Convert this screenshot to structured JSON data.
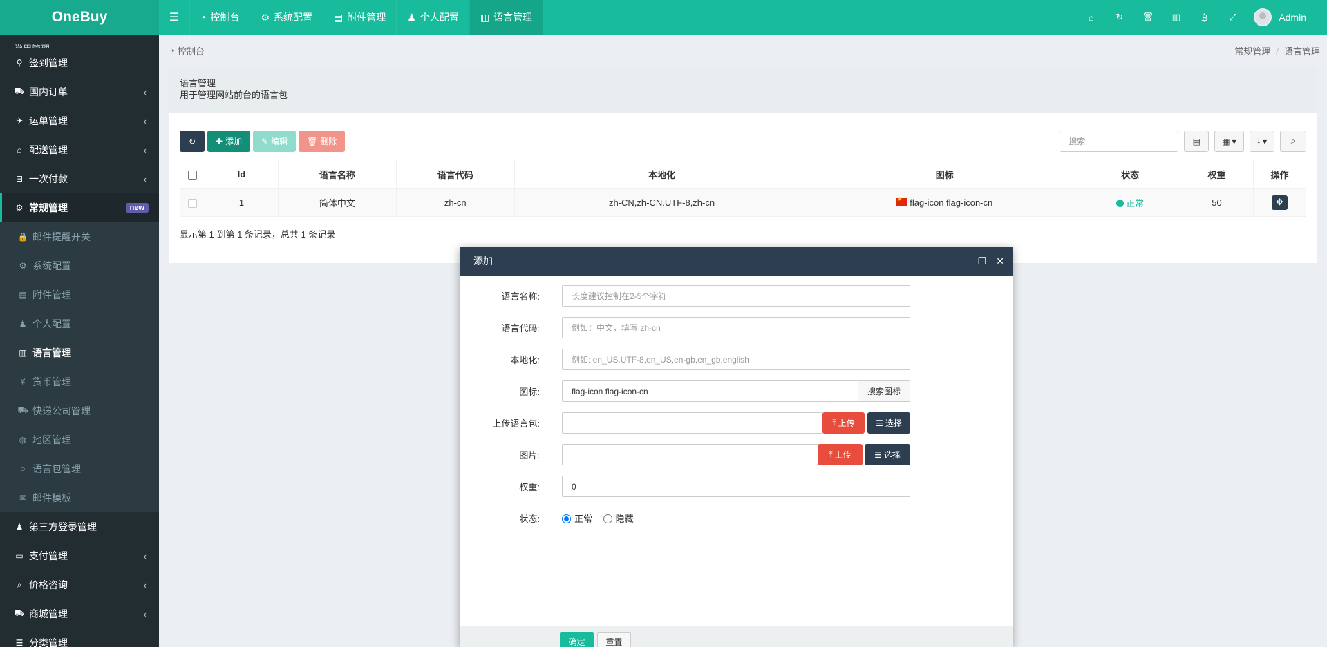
{
  "app": {
    "logo": "OneBuy"
  },
  "header": {
    "tabs": [
      {
        "icon": "dashboard-icon",
        "label": "控制台"
      },
      {
        "icon": "gear-icon",
        "label": "系统配置"
      },
      {
        "icon": "file-icon",
        "label": "附件管理"
      },
      {
        "icon": "user-icon",
        "label": "个人配置"
      },
      {
        "icon": "language-icon",
        "label": "语言管理"
      }
    ],
    "user": "Admin"
  },
  "sidebar": {
    "cut_label": "常用管理",
    "items": [
      {
        "label": "签到管理",
        "icon": "map-marker-icon",
        "arrow": false
      },
      {
        "label": "国内订单",
        "icon": "cart-icon",
        "arrow": true
      },
      {
        "label": "运单管理",
        "icon": "plane-icon",
        "arrow": true
      },
      {
        "label": "配送管理",
        "icon": "bank-icon",
        "arrow": true
      },
      {
        "label": "一次付款",
        "icon": "basket-icon",
        "arrow": true
      },
      {
        "label": "常规管理",
        "icon": "cogs-icon",
        "badge": "new",
        "active": true
      }
    ],
    "subitems": [
      {
        "label": "邮件提醒开关",
        "icon": "lock-icon"
      },
      {
        "label": "系统配置",
        "icon": "gear-icon"
      },
      {
        "label": "附件管理",
        "icon": "file-icon"
      },
      {
        "label": "个人配置",
        "icon": "user-icon"
      },
      {
        "label": "语言管理",
        "icon": "language-icon",
        "active": true
      },
      {
        "label": "货币管理",
        "icon": "yen-icon"
      },
      {
        "label": "快递公司管理",
        "icon": "truck-icon"
      },
      {
        "label": "地区管理",
        "icon": "globe-icon"
      },
      {
        "label": "语言包管理",
        "icon": "circle-icon"
      },
      {
        "label": "邮件模板",
        "icon": "envelope-icon"
      }
    ],
    "items_after": [
      {
        "label": "第三方登录管理",
        "icon": "users-icon",
        "arrow": false
      },
      {
        "label": "支付管理",
        "icon": "credit-card-icon",
        "arrow": true
      },
      {
        "label": "价格咨询",
        "icon": "search-icon",
        "arrow": true
      },
      {
        "label": "商城管理",
        "icon": "cart-icon",
        "arrow": true
      },
      {
        "label": "分类管理",
        "icon": "list-icon",
        "arrow": false
      }
    ]
  },
  "breadcrumb": {
    "left": "控制台",
    "right": [
      "常规管理",
      "语言管理"
    ]
  },
  "panel": {
    "title": "语言管理",
    "subtitle": "用于管理网站前台的语言包"
  },
  "toolbar": {
    "add": "添加",
    "edit": "编辑",
    "delete": "删除",
    "search_placeholder": "搜索"
  },
  "table": {
    "headers": [
      "Id",
      "语言名称",
      "语言代码",
      "本地化",
      "图标",
      "状态",
      "权重",
      "操作"
    ],
    "rows": [
      {
        "id": "1",
        "name": "简体中文",
        "code": "zh-cn",
        "locale": "zh-CN,zh-CN.UTF-8,zh-cn",
        "icon": "flag-icon flag-icon-cn",
        "status": "正常",
        "weight": "50"
      }
    ],
    "pageinfo": "显示第 1 到第 1 条记录，总共 1 条记录"
  },
  "modal": {
    "title": "添加",
    "fields": {
      "name": {
        "label": "语言名称:",
        "placeholder": "长度建议控制在2-5个字符"
      },
      "code": {
        "label": "语言代码:",
        "placeholder": "例如：中文，填写 zh-cn"
      },
      "locale": {
        "label": "本地化:",
        "placeholder": "例如: en_US.UTF-8,en_US,en-gb,en_gb,english"
      },
      "icon": {
        "label": "图标:",
        "value": "flag-icon flag-icon-cn",
        "addon": "搜索图标"
      },
      "package": {
        "label": "上传语言包:",
        "upload": "上传",
        "choose": "选择"
      },
      "image": {
        "label": "图片:",
        "upload": "上传",
        "choose": "选择"
      },
      "weight": {
        "label": "权重:",
        "value": "0"
      },
      "status": {
        "label": "状态:",
        "options": [
          "正常",
          "隐藏"
        ]
      }
    },
    "confirm": "确定",
    "reset": "重置"
  }
}
